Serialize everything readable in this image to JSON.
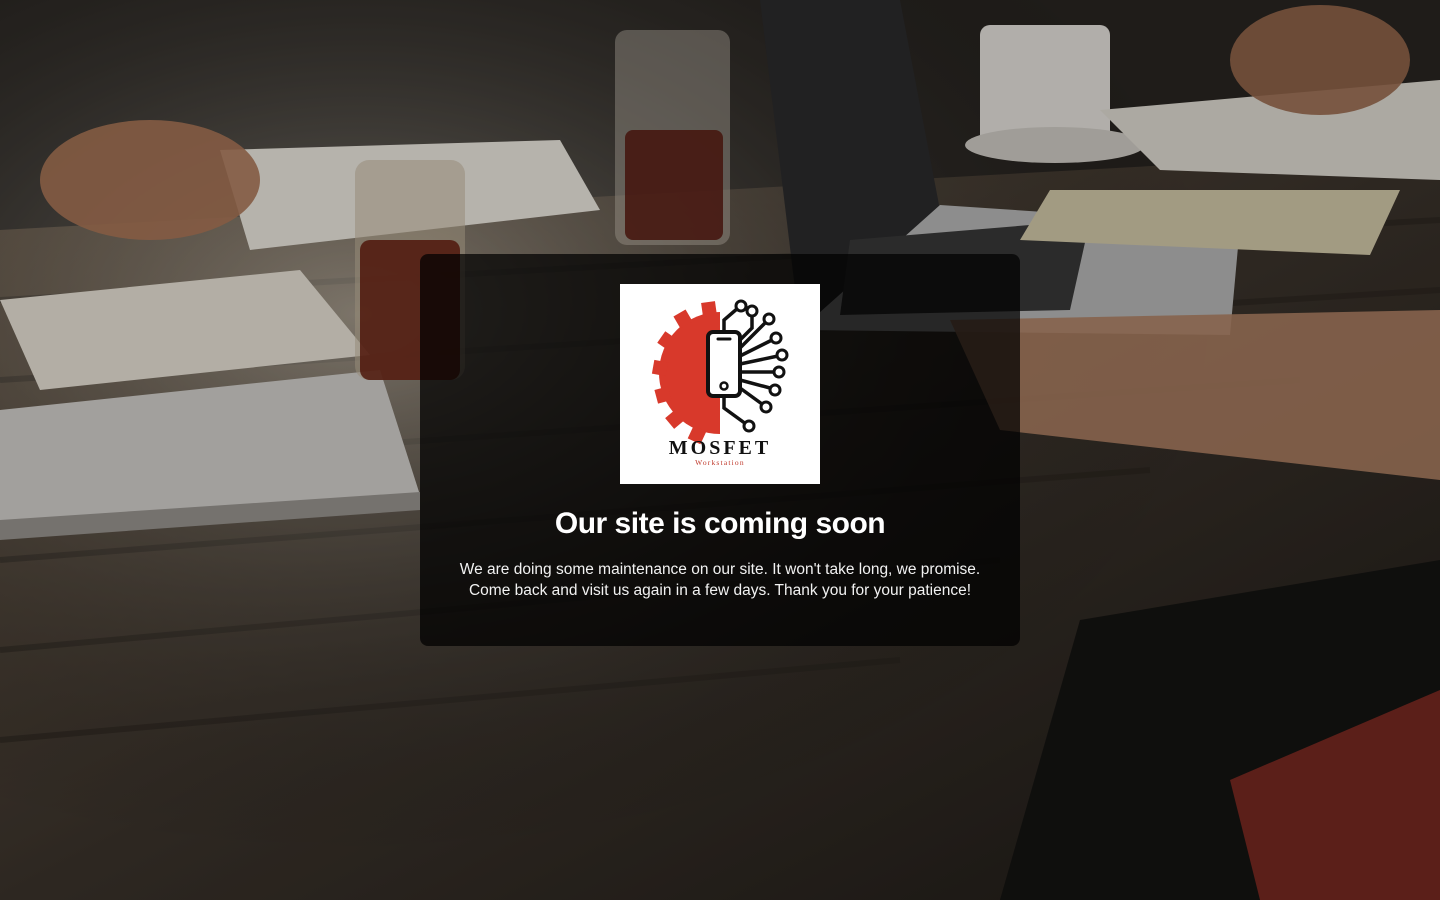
{
  "page": {
    "heading": "Our site is coming soon",
    "message_line_1": "We are doing some maintenance on our site. It won't take long, we promise.",
    "message_line_2": "Come back and visit us again in a few days. Thank you for your patience!"
  },
  "logo": {
    "name": "MOSFET",
    "tagline": "Workstation",
    "icon": "gear-circuit-phone-icon",
    "colors": {
      "gear": "#d8392b",
      "ink": "#111111",
      "tagline": "#c0392b"
    }
  },
  "background": {
    "icon": "meeting-table-photo",
    "overlay": "#000000"
  }
}
